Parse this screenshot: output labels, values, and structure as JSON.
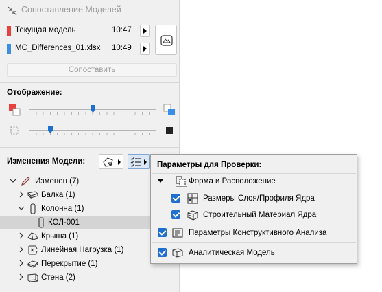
{
  "palette": {
    "title": "Сопоставление Моделей",
    "models": [
      {
        "name": "Текущая модель",
        "time": "10:47",
        "color": "#e8403a"
      },
      {
        "name": "MC_Differences_01.xlsx",
        "time": "10:49",
        "color": "#3b8ee8"
      }
    ],
    "compare_label": "Сопоставить",
    "display_label": "Отображение:",
    "sliders": [
      {
        "value": 0.5
      },
      {
        "value": 0.17
      }
    ],
    "changes_label": "Изменения Модели:"
  },
  "tree": [
    {
      "label": "Изменен (7)",
      "icon": "pencil-icon",
      "expander": "down",
      "level": 0
    },
    {
      "label": "Балка (1)",
      "icon": "beam-icon",
      "expander": "right",
      "level": 1
    },
    {
      "label": "Колонна (1)",
      "icon": "column-icon",
      "expander": "down",
      "level": 1
    },
    {
      "label": "КОЛ-001",
      "icon": "column-element-icon",
      "expander": "none",
      "level": 2,
      "selected": true
    },
    {
      "label": "Крыша (1)",
      "icon": "roof-icon",
      "expander": "right",
      "level": 1
    },
    {
      "label": "Линейная Нагрузка (1)",
      "icon": "line-load-icon",
      "expander": "right",
      "level": 1
    },
    {
      "label": "Перекрытие (1)",
      "icon": "slab-icon",
      "expander": "right",
      "level": 1
    },
    {
      "label": "Стена (2)",
      "icon": "wall-icon",
      "expander": "right",
      "level": 1
    }
  ],
  "popup": {
    "title": "Параметры для Проверки:",
    "items": [
      {
        "label": "Форма и Расположение",
        "checked": false,
        "expander": true,
        "icon": "shape-position-icon"
      },
      {
        "label": "Размеры Слоя/Профиля Ядра",
        "checked": true,
        "icon": "layer-size-icon"
      },
      {
        "label": "Строительный Материал Ядра",
        "checked": true,
        "icon": "material-icon"
      },
      {
        "label": "Параметры Конструктивного Анализа",
        "checked": true,
        "icon": "structural-analysis-icon"
      },
      {
        "label": "Аналитическая Модель",
        "checked": true,
        "icon": "analytical-model-icon"
      }
    ]
  },
  "colors": {
    "accent": "#1f6fd1",
    "current_model": "#e8403a",
    "compared_model": "#3b8ee8"
  }
}
